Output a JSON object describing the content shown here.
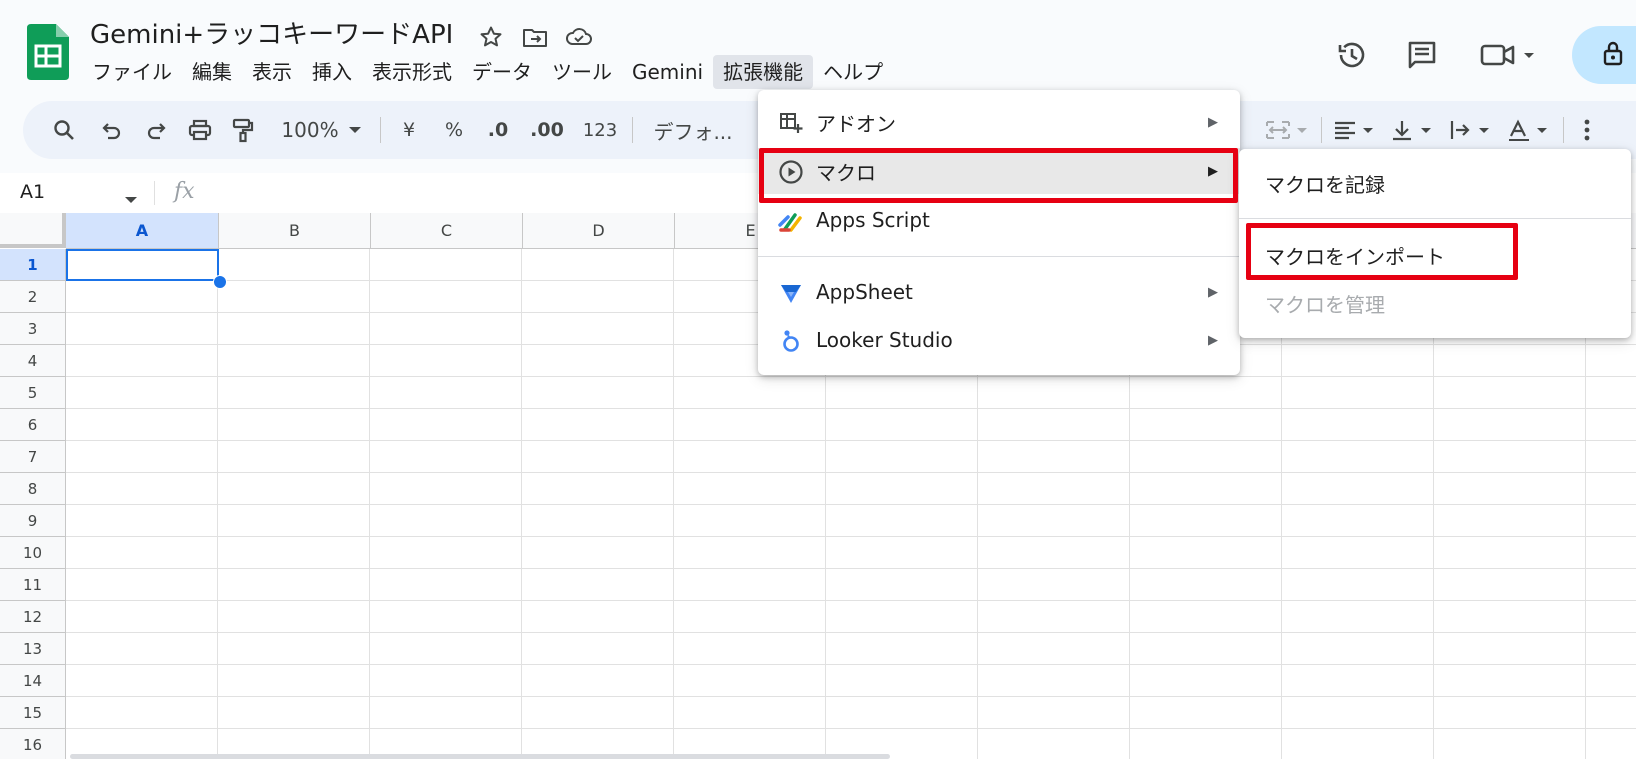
{
  "header": {
    "title": "Gemini+ラッコキーワードAPI",
    "menus": [
      {
        "label": "ファイル"
      },
      {
        "label": "編集"
      },
      {
        "label": "表示"
      },
      {
        "label": "挿入"
      },
      {
        "label": "表示形式"
      },
      {
        "label": "データ"
      },
      {
        "label": "ツール"
      },
      {
        "label": "Gemini"
      },
      {
        "label": "拡張機能",
        "active": true
      },
      {
        "label": "ヘルプ"
      }
    ]
  },
  "toolbar": {
    "zoom": "100%",
    "currency": "¥",
    "percent": "%",
    "dec_decrease": ".0",
    "dec_increase": ".00",
    "number_format": "123",
    "font": "デフォ..."
  },
  "formula_bar": {
    "cell_ref": "A1",
    "fx": "fx"
  },
  "grid": {
    "columns": [
      "A",
      "B",
      "C",
      "D",
      "E"
    ],
    "rows": [
      "1",
      "2",
      "3",
      "4",
      "5",
      "6",
      "7",
      "8",
      "9",
      "10",
      "11",
      "12",
      "13",
      "14",
      "15",
      "16"
    ],
    "selected_cell": "A1"
  },
  "extensions_menu": {
    "items": [
      {
        "label": "アドオン",
        "icon": "addon-icon",
        "submenu": true
      },
      {
        "label": "マクロ",
        "icon": "macro-play-icon",
        "submenu": true,
        "highlighted": true
      },
      {
        "label": "Apps Script",
        "icon": "apps-script-icon",
        "submenu": false
      },
      {
        "label": "AppSheet",
        "icon": "appsheet-icon",
        "submenu": true
      },
      {
        "label": "Looker Studio",
        "icon": "looker-studio-icon",
        "submenu": true
      }
    ]
  },
  "macro_submenu": {
    "items": [
      {
        "label": "マクロを記録",
        "disabled": false
      },
      {
        "label": "マクロをインポート",
        "disabled": false
      },
      {
        "label": "マクロを管理",
        "disabled": true
      }
    ]
  },
  "colors": {
    "highlight_box": "#e60012",
    "accent": "#1a73e8",
    "sheets_green": "#0f9d58",
    "share_button": "#c2e7ff"
  }
}
